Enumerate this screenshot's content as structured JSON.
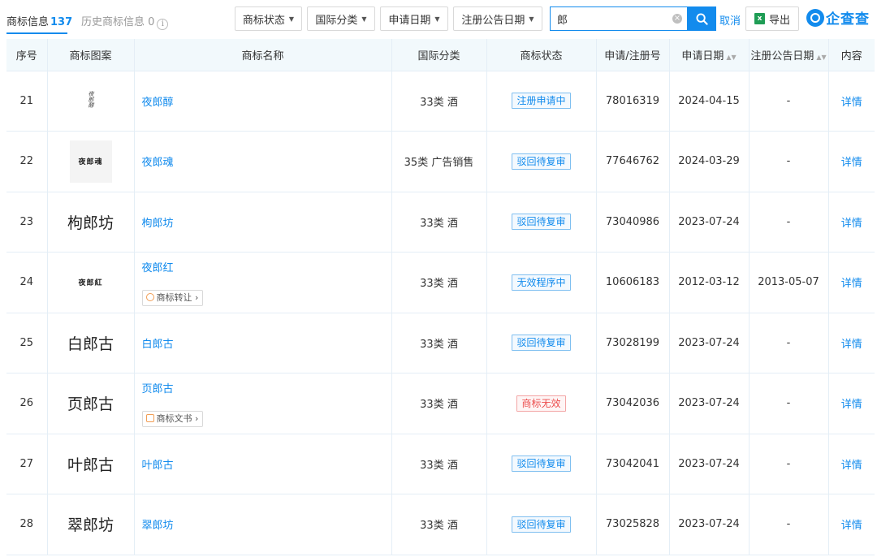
{
  "tabs": {
    "active_label": "商标信息",
    "active_count": "137",
    "history_label": "历史商标信息 0",
    "info_glyph": "i"
  },
  "filters": [
    {
      "label": "商标状态"
    },
    {
      "label": "国际分类"
    },
    {
      "label": "申请日期"
    },
    {
      "label": "注册公告日期"
    }
  ],
  "search": {
    "value": "郎",
    "placeholder": ""
  },
  "actions": {
    "cancel": "取消",
    "export": "导出",
    "excel_glyph": "x"
  },
  "brand": {
    "name": "企查查"
  },
  "table": {
    "headers": {
      "index": "序号",
      "image": "商标图案",
      "name": "商标名称",
      "class": "国际分类",
      "status": "商标状态",
      "reg_no": "申请/注册号",
      "apply_date": "申请日期",
      "pub_date": "注册公告日期",
      "detail": "内容"
    },
    "rows": [
      {
        "index": "21",
        "image_text": "夜郎醇",
        "image_style": "vert",
        "name": "夜郎醇",
        "tag": "",
        "tag_kind": "",
        "class": "33类 酒",
        "status": "注册申请中",
        "status_color": "blue",
        "reg_no": "78016319",
        "apply_date": "2024-04-15",
        "pub_date": "-",
        "detail": "详情"
      },
      {
        "index": "22",
        "image_text": "夜郎魂",
        "image_style": "box",
        "name": "夜郎魂",
        "tag": "",
        "tag_kind": "",
        "class": "35类 广告销售",
        "status": "驳回待复审",
        "status_color": "blue",
        "reg_no": "77646762",
        "apply_date": "2024-03-29",
        "pub_date": "-",
        "detail": "详情"
      },
      {
        "index": "23",
        "image_text": "枸郎坊",
        "image_style": "serif",
        "name": "枸郎坊",
        "tag": "",
        "tag_kind": "",
        "class": "33类 酒",
        "status": "驳回待复审",
        "status_color": "blue",
        "reg_no": "73040986",
        "apply_date": "2023-07-24",
        "pub_date": "-",
        "detail": "详情"
      },
      {
        "index": "24",
        "image_text": "夜郎紅",
        "image_style": "small",
        "name": "夜郎红",
        "tag": "商标转让",
        "tag_kind": "transfer",
        "class": "33类 酒",
        "status": "无效程序中",
        "status_color": "blue",
        "reg_no": "10606183",
        "apply_date": "2012-03-12",
        "pub_date": "2013-05-07",
        "detail": "详情"
      },
      {
        "index": "25",
        "image_text": "白郎古",
        "image_style": "serif",
        "name": "白郎古",
        "tag": "",
        "tag_kind": "",
        "class": "33类 酒",
        "status": "驳回待复审",
        "status_color": "blue",
        "reg_no": "73028199",
        "apply_date": "2023-07-24",
        "pub_date": "-",
        "detail": "详情"
      },
      {
        "index": "26",
        "image_text": "页郎古",
        "image_style": "serif",
        "name": "页郎古",
        "tag": "商标文书",
        "tag_kind": "doc",
        "class": "33类 酒",
        "status": "商标无效",
        "status_color": "red",
        "reg_no": "73042036",
        "apply_date": "2023-07-24",
        "pub_date": "-",
        "detail": "详情"
      },
      {
        "index": "27",
        "image_text": "叶郎古",
        "image_style": "serif",
        "name": "叶郎古",
        "tag": "",
        "tag_kind": "",
        "class": "33类 酒",
        "status": "驳回待复审",
        "status_color": "blue",
        "reg_no": "73042041",
        "apply_date": "2023-07-24",
        "pub_date": "-",
        "detail": "详情"
      },
      {
        "index": "28",
        "image_text": "翠郎坊",
        "image_style": "serif",
        "name": "翠郎坊",
        "tag": "",
        "tag_kind": "",
        "class": "33类 酒",
        "status": "驳回待复审",
        "status_color": "blue",
        "reg_no": "73025828",
        "apply_date": "2023-07-24",
        "pub_date": "-",
        "detail": "详情"
      }
    ]
  },
  "colors": {
    "accent": "#128bed",
    "status_red": "#ec4d4d",
    "header_bg": "#f2f9fc"
  }
}
